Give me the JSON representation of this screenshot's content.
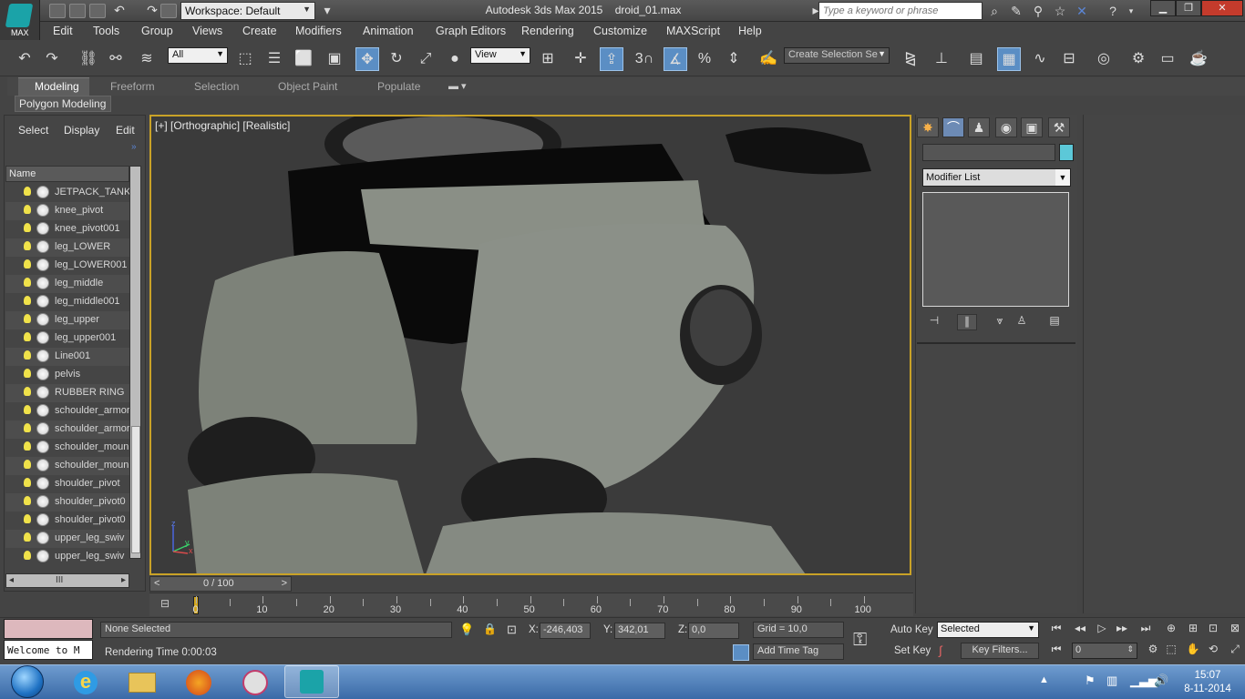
{
  "titlebar": {
    "app_button_label": "MAX",
    "workspace": "Workspace: Default",
    "app_title": "Autodesk 3ds Max  2015",
    "file_name": "droid_01.max",
    "search_placeholder": "Type a keyword or phrase"
  },
  "menu": [
    "Edit",
    "Tools",
    "Group",
    "Views",
    "Create",
    "Modifiers",
    "Animation",
    "Graph Editors",
    "Rendering",
    "Customize",
    "MAXScript",
    "Help"
  ],
  "toolbar": {
    "selection_filter": "All",
    "ref_coord": "View",
    "selection_set_placeholder": "Create Selection Se",
    "snap_label": "3"
  },
  "ribbon": {
    "tabs": [
      "Modeling",
      "Freeform",
      "Selection",
      "Object Paint",
      "Populate"
    ],
    "active_tab": "Modeling",
    "panel": "Polygon Modeling"
  },
  "explorer": {
    "menu": [
      "Select",
      "Display",
      "Edit"
    ],
    "column_header": "Name",
    "objects": [
      "JETPACK_TANK",
      "knee_pivot",
      "knee_pivot001",
      "leg_LOWER",
      "leg_LOWER001",
      "leg_middle",
      "leg_middle001",
      "leg_upper",
      "leg_upper001",
      "Line001",
      "pelvis",
      "RUBBER RING",
      "schoulder_armor",
      "schoulder_armor",
      "schoulder_moun",
      "schoulder_moun",
      "shoulder_pivot",
      "shoulder_pivot0",
      "shoulder_pivot0",
      "upper_leg_swiv",
      "upper_leg_swiv"
    ],
    "hscroll_label": "III"
  },
  "viewport": {
    "label": "[+] [Orthographic] [Realistic]",
    "axis_x": "x",
    "axis_y": "y",
    "axis_z": "z"
  },
  "timeline": {
    "slider_value": "0 / 100",
    "slider_prev": "<",
    "slider_next": ">",
    "ticks": [
      "0",
      "10",
      "20",
      "30",
      "40",
      "50",
      "60",
      "70",
      "80",
      "90",
      "100"
    ]
  },
  "command_panel": {
    "modifier_list": "Modifier List",
    "tabs": [
      "create-icon",
      "modify-icon",
      "hierarchy-icon",
      "motion-icon",
      "display-icon",
      "utilities-icon"
    ]
  },
  "status": {
    "selection": "None Selected",
    "prompt": "Rendering Time  0:00:03",
    "listener_text": "Welcome to M",
    "x_label": "X:",
    "x_value": "-246,403",
    "y_label": "Y:",
    "y_value": "342,01",
    "z_label": "Z:",
    "z_value": "0,0",
    "grid": "Grid = 10,0",
    "add_time_tag": "Add Time Tag",
    "auto_key": "Auto Key",
    "set_key": "Set Key",
    "key_mode": "Selected",
    "key_filters": "Key Filters...",
    "current_frame": "0"
  },
  "taskbar": {
    "time": "15:07",
    "date": "8-11-2014"
  },
  "colors": {
    "viewport_border": "#c9a227",
    "object_color": "#5cc8d8",
    "listener": "#ddb8bd",
    "active_button": "#5b8ec4"
  }
}
